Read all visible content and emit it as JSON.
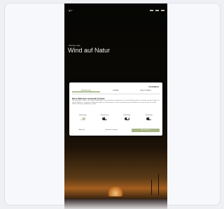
{
  "page": {
    "logo": "·go·",
    "eyebrow": "Windenergie",
    "title": "Wind auf Natur"
  },
  "consent": {
    "brand_logo": "Cookiebot",
    "tabs": [
      {
        "label": "Zustimmung",
        "active": true
      },
      {
        "label": "Details",
        "active": false
      },
      {
        "label": "Über Cookies",
        "active": false
      }
    ],
    "heading": "Diese Webseite verwendet Cookies",
    "body": "Wir verwenden Cookies, um Inhalte und Anzeigen zu personalisieren, Funktionen für soziale Medien anbieten zu können und die Zugriffe auf unsere Website zu analysieren. Außerdem geben wir Informationen zu Ihrer Verwendung unserer Website an unsere Partner für soziale Medien, Werbung und Analysen weiter.",
    "categories": [
      {
        "label": "Notwendig",
        "on": true
      },
      {
        "label": "Präferenzen",
        "on": false
      },
      {
        "label": "Statistiken",
        "on": false
      },
      {
        "label": "Marketing",
        "on": false
      }
    ],
    "buttons": {
      "deny": "Ablehnen",
      "allow_selection": "Auswahl erlauben",
      "allow_all": "Alle zulassen"
    }
  }
}
